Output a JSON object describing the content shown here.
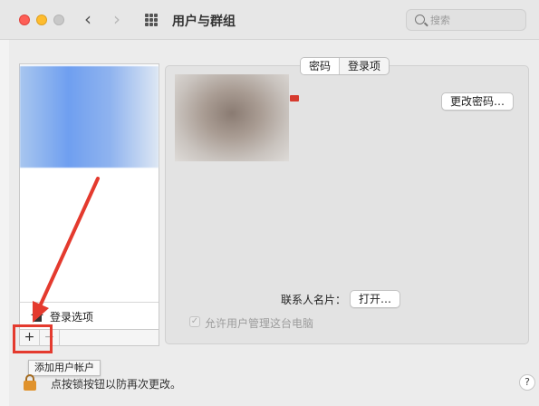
{
  "window": {
    "title": "用户与群组",
    "search": {
      "placeholder": "搜索"
    },
    "nav": {
      "back": "‹",
      "forward": "›"
    }
  },
  "sidebar": {
    "login_options_label": "登录选项",
    "add_symbol": "+",
    "remove_symbol": "−",
    "add_tooltip": "添加用户帐户"
  },
  "tabs": [
    {
      "label": "密码",
      "active": true
    },
    {
      "label": "登录项",
      "active": false
    }
  ],
  "main": {
    "change_password_button": "更改密码…",
    "contact_card_label": "联系人名片：",
    "open_button": "打开…",
    "allow_admin_label": "允许用户管理这台电脑",
    "allow_admin_checked": true
  },
  "footer": {
    "lock_text": "点按锁按钮以防再次更改。",
    "help": "?"
  },
  "colors": {
    "annotation": "#e43a2e",
    "lock": "#e0922c"
  },
  "icons": [
    "close-icon",
    "minimize-icon",
    "zoom-icon",
    "chevron-left-icon",
    "chevron-right-icon",
    "grid-icon",
    "search-icon",
    "house-icon",
    "lock-icon",
    "arrow-icon"
  ]
}
